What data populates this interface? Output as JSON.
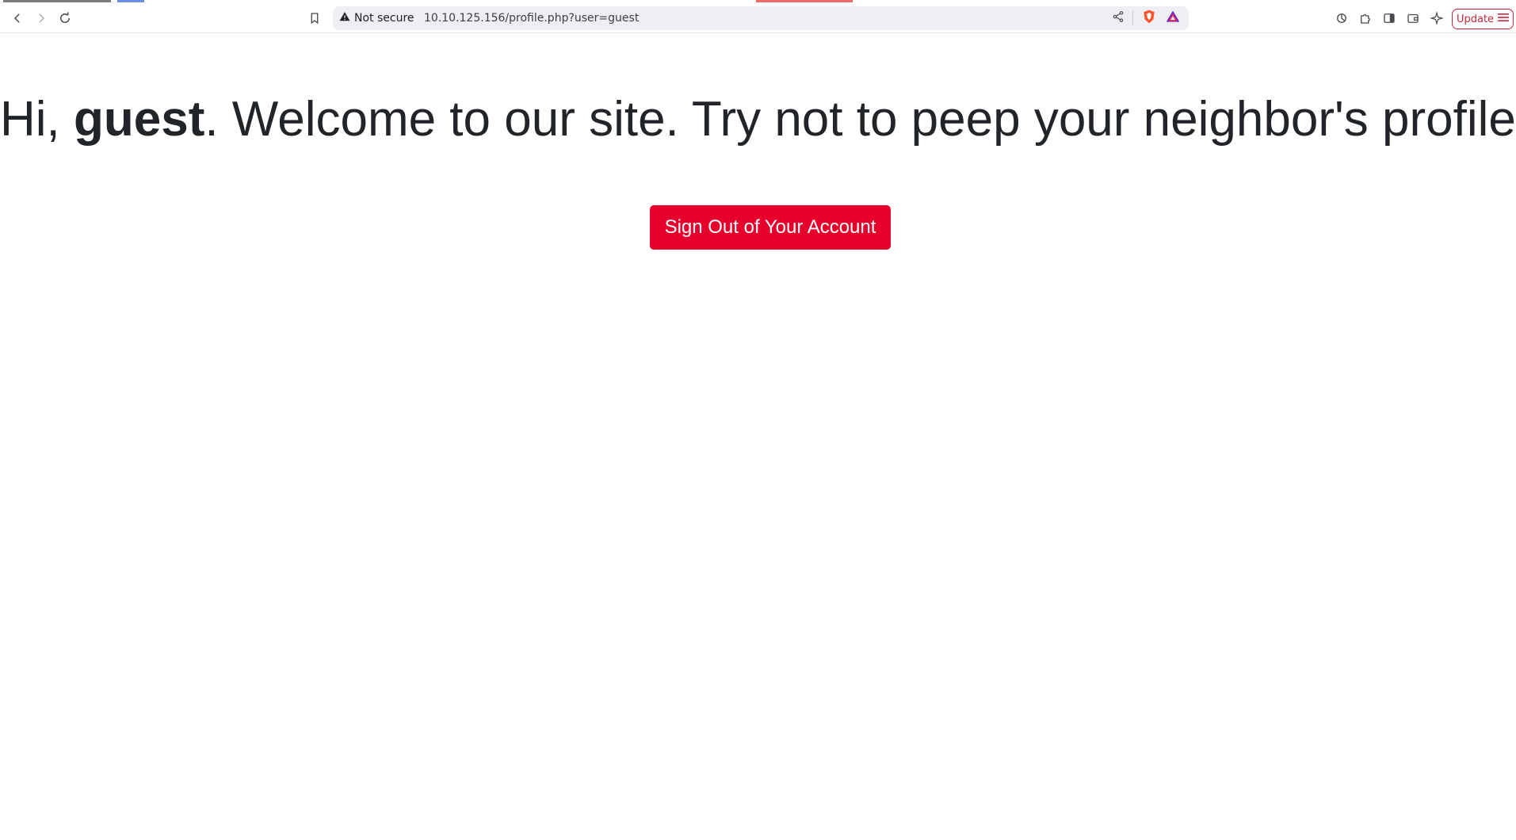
{
  "browser": {
    "security_label": "Not secure",
    "url": "10.10.125.156/profile.php?user=guest",
    "update_label": "Update",
    "icons": {
      "back": "back-arrow-icon",
      "forward": "forward-arrow-icon",
      "reload": "reload-icon",
      "bookmark": "bookmark-icon",
      "warning": "warning-icon",
      "share": "share-icon",
      "brave_shields": "brave-shield-icon",
      "brave_rewards": "brave-rewards-icon",
      "leo": "leo-icon",
      "extensions": "puzzle-icon",
      "sidebar": "sidebar-icon",
      "wallet": "wallet-icon",
      "sparkle": "sparkle-icon",
      "menu": "hamburger-icon"
    },
    "colors": {
      "update_accent": "#c4283a",
      "omnibox_bg": "#efeff3"
    }
  },
  "page": {
    "greeting_prefix": "Hi, ",
    "username": "guest",
    "greeting_suffix": ". Welcome to our site. Try not to peep your neighbor's profile.",
    "signout_label": "Sign Out of Your Account",
    "colors": {
      "button_bg": "#e8002c",
      "text": "#212529"
    }
  }
}
